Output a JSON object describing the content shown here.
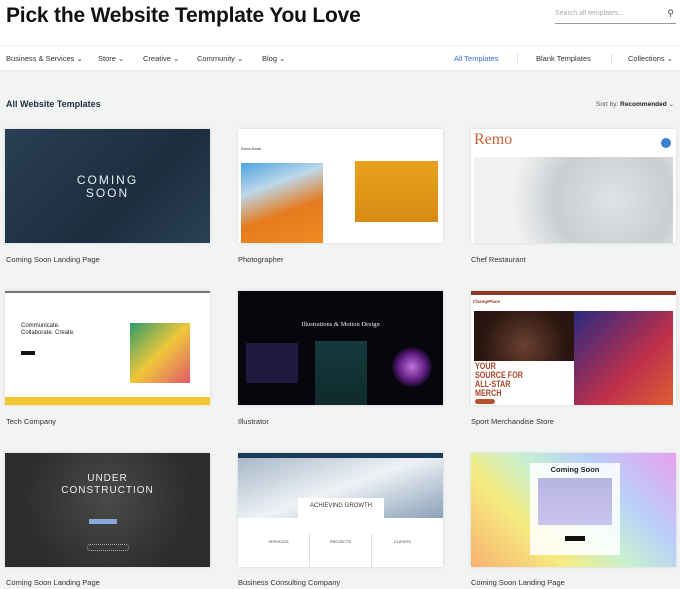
{
  "header": {
    "title": "Pick the Website Template You Love",
    "search_placeholder": "Search all templates...",
    "search_icon": "magnifier"
  },
  "nav": {
    "categories": [
      "Business & Services",
      "Store",
      "Creative",
      "Community",
      "Blog"
    ],
    "all_templates": "All Templates",
    "blank_templates": "Blank Templates",
    "collections": "Collections"
  },
  "section": {
    "title": "All Website Templates",
    "sort_label": "Sort by:",
    "sort_value": "Recommended"
  },
  "accent": "#3a6fd8",
  "templates": [
    {
      "name": "Coming Soon Landing Page",
      "preview_text": "COMING SOON"
    },
    {
      "name": "Photographer",
      "preview_text": "Dona Kane"
    },
    {
      "name": "Chef Restaurant",
      "preview_text": "Remo"
    },
    {
      "name": "Tech Company",
      "preview_text": "Communicate. Collaborate. Create."
    },
    {
      "name": "Illustrator",
      "preview_text": "Illustrations & Motion Design"
    },
    {
      "name": "Sport Merchandise Store",
      "preview_text": "YOUR SOURCE FOR ALL-STAR MERCH",
      "brand": "ChampPlace"
    },
    {
      "name": "Coming Soon Landing Page",
      "preview_text": "UNDER CONSTRUCTION"
    },
    {
      "name": "Business Consulting Company",
      "preview_text": "ACHIEVING GROWTH",
      "columns": [
        "SERVICES",
        "PROJECTS",
        "CLIENTS"
      ]
    },
    {
      "name": "Coming Soon Landing Page",
      "preview_text": "Coming Soon"
    }
  ]
}
